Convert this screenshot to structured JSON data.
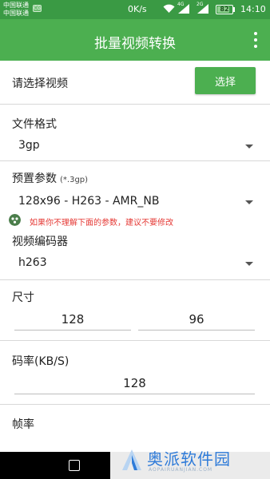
{
  "status_bar": {
    "carrier_1": "中国联通",
    "carrier_2": "中国联通",
    "sim_badge": "CG",
    "speed": "0K/s",
    "signal_1_label": "4G",
    "signal_2_label": "2G",
    "battery": "82",
    "battery_level": 0.82,
    "time": "14:10",
    "icons": [
      "wifi-icon",
      "signal-icon",
      "signal-icon",
      "battery-icon"
    ]
  },
  "app_bar": {
    "title": "批量视频转换",
    "menu_icon": "overflow-menu-icon"
  },
  "select_video": {
    "label": "请选择视频",
    "button": "选择"
  },
  "format": {
    "label": "文件格式",
    "value": "3gp"
  },
  "preset": {
    "label": "预置参数",
    "hint": "(*.3gp)",
    "value": "128x96 - H263 - AMR_NB"
  },
  "warning": {
    "text": "如果你不理解下面的参数，建议不要修改"
  },
  "encoder": {
    "label": "视频编码器",
    "value": "h263"
  },
  "size": {
    "label": "尺寸",
    "width": "128",
    "height": "96"
  },
  "bitrate": {
    "label": "码率(KB/S)",
    "value": "128"
  },
  "framerate": {
    "label": "帧率"
  },
  "watermark": {
    "text": "奥派软件园",
    "sub": "AOPAIRUANJIAN.COM"
  },
  "colors": {
    "primary": "#4caf50",
    "status_bar": "#3a9a44",
    "warning": "#e53935"
  }
}
